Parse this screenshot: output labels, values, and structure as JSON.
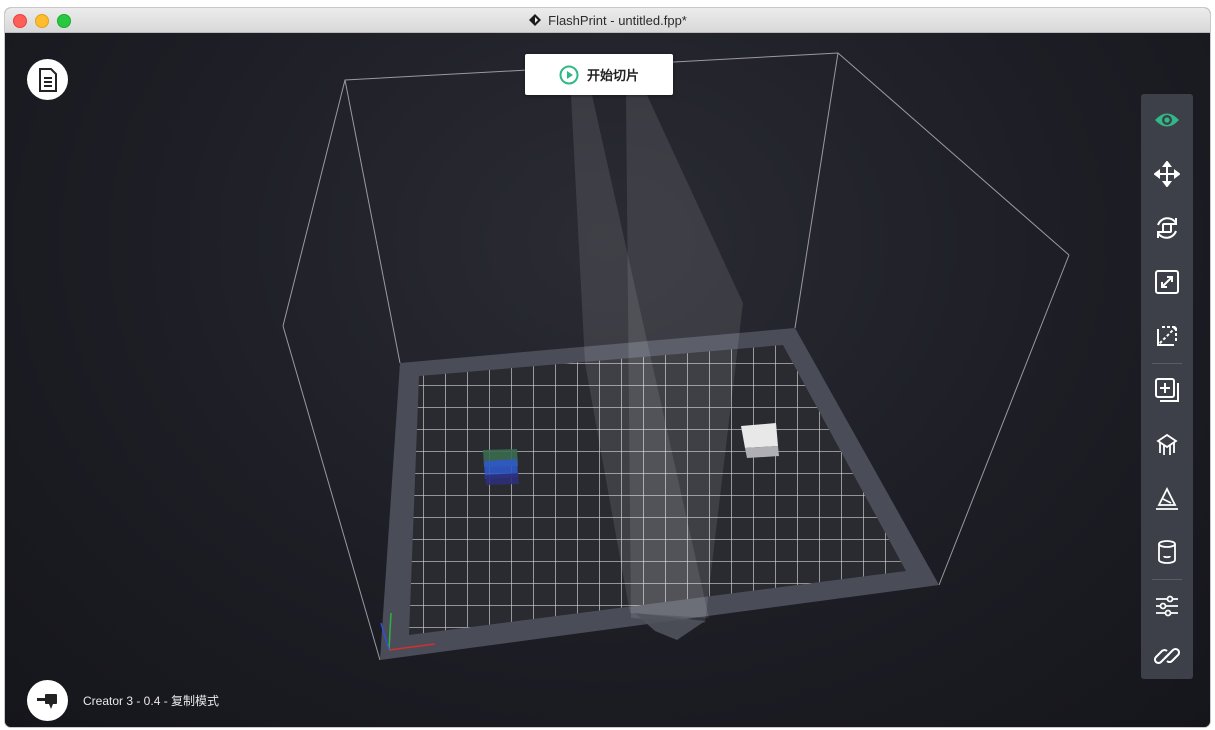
{
  "window": {
    "title": "FlashPrint - untitled.fpp*"
  },
  "toolbar_top": {
    "start_slice_label": "开始切片"
  },
  "status": {
    "machine_label": "Creator 3 - 0.4 - 复制模式"
  },
  "icons": {
    "file": "file-icon",
    "play": "play-icon",
    "machine": "extruder-icon",
    "view": "eye-icon",
    "move": "move-icon",
    "rotate": "rotate-icon",
    "scale": "scale-icon",
    "cut": "cut-icon",
    "add": "add-object-icon",
    "support": "support-icon",
    "lay_flat": "lay-flat-icon",
    "hollow": "hollow-icon",
    "settings": "settings-sliders-icon",
    "link": "link-icon"
  },
  "colors": {
    "accent": "#2fb986",
    "viewport_bg": "#1d1e25",
    "toolbar_bg": "#3e4049",
    "plate": "#4a4c58",
    "grid": "#e6e6e6"
  }
}
